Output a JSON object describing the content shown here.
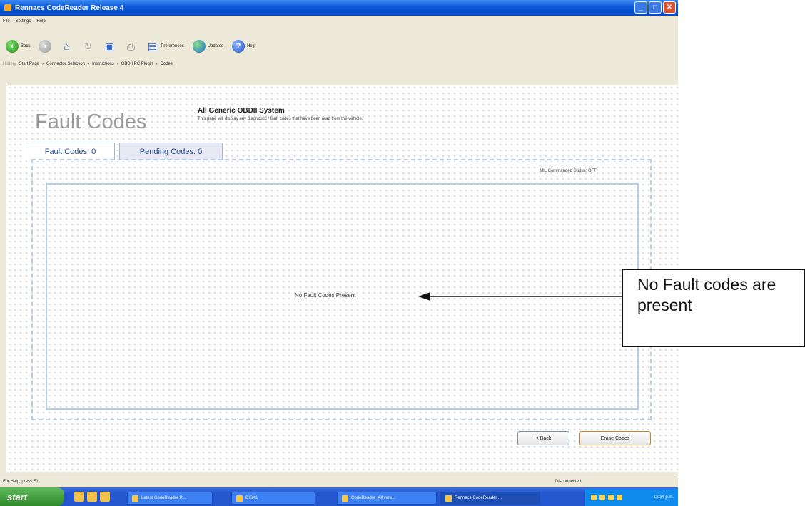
{
  "window": {
    "title": "Rennacs CodeReader Release 4"
  },
  "menu": [
    "File",
    "Settings",
    "Help"
  ],
  "toolbar": {
    "back": "Back",
    "preferences": "Preferences",
    "updates": "Updates",
    "help": "Help"
  },
  "breadcrumb": {
    "label": "History",
    "items": [
      "Start Page",
      "Connector Selection",
      "Instructions",
      "OBDII PC Plugin",
      "Codes"
    ]
  },
  "page": {
    "title": "Fault Codes",
    "system_name": "All Generic OBDII System",
    "description": "This page will display any diagnostic / fault codes that have been read from the vehicle.",
    "tabs": [
      "Fault Codes: 0",
      "Pending Codes: 0"
    ],
    "mil_label": "MIL Commanded Status:",
    "mil_value": "OFF",
    "empty_message": "No Fault Codes Present",
    "back_button": "< Back",
    "erase_button": "Erase Codes"
  },
  "statusbar": {
    "help": "For Help, press F1",
    "connection": "Disconnected"
  },
  "taskbar": {
    "start": "start",
    "tasks": [
      "Latest CodeReader P...",
      "DISK1",
      "CodeReader_All.vers...",
      "Rennacs CodeReader ..."
    ],
    "clock": "12:34 p.m."
  },
  "callout": {
    "text": "No Fault codes are present"
  },
  "colors": {
    "titlebar": "#0a58d8",
    "taskbar": "#2457cf",
    "tab_text": "#2a4a8a",
    "panel_border": "#b8cbe3"
  }
}
